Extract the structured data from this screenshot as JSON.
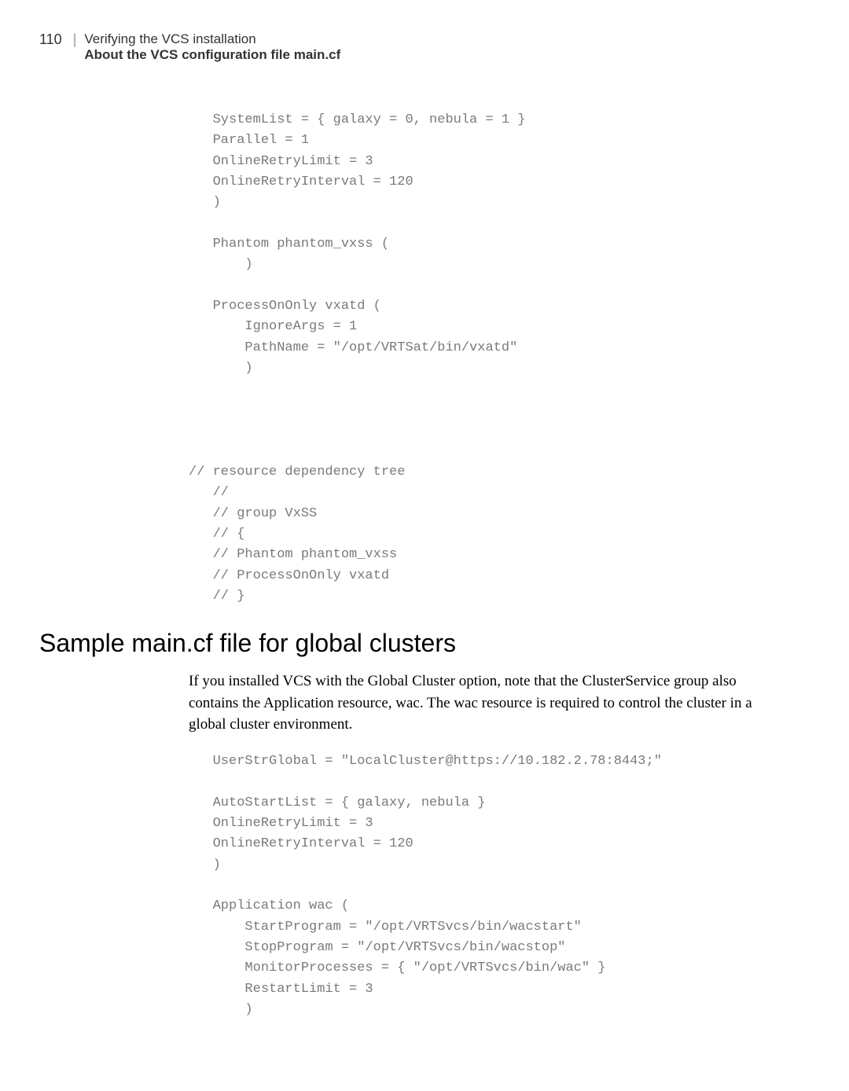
{
  "header": {
    "page_num": "110",
    "line1": "Verifying the VCS installation",
    "line2": "About the VCS configuration file main.cf"
  },
  "code1": "   SystemList = { galaxy = 0, nebula = 1 }\n   Parallel = 1\n   OnlineRetryLimit = 3\n   OnlineRetryInterval = 120\n   )\n\n   Phantom phantom_vxss (\n       )\n\n   ProcessOnOnly vxatd (\n       IgnoreArgs = 1\n       PathName = \"/opt/VRTSat/bin/vxatd\"\n       )\n\n\n\n\n// resource dependency tree\n   //\n   // group VxSS\n   // {\n   // Phantom phantom_vxss\n   // ProcessOnOnly vxatd\n   // }",
  "heading": "Sample main.cf file for global clusters",
  "paragraph": "If you installed VCS with the Global Cluster option, note that the ClusterService group also contains the Application resource, wac. The wac resource is required to control the cluster in a global cluster environment.",
  "code2": "   UserStrGlobal = \"LocalCluster@https://10.182.2.78:8443;\"\n\n   AutoStartList = { galaxy, nebula }\n   OnlineRetryLimit = 3\n   OnlineRetryInterval = 120\n   )\n\n   Application wac (\n       StartProgram = \"/opt/VRTSvcs/bin/wacstart\"\n       StopProgram = \"/opt/VRTSvcs/bin/wacstop\"\n       MonitorProcesses = { \"/opt/VRTSvcs/bin/wac\" }\n       RestartLimit = 3\n       )"
}
